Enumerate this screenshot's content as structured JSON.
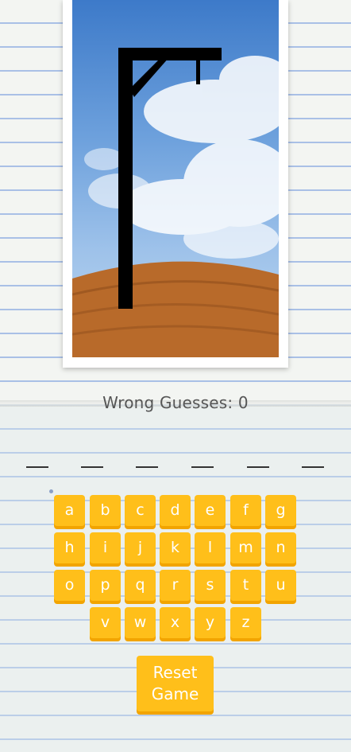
{
  "status": {
    "wrong_label": "Wrong Guesses: 0",
    "wrong_count": 0
  },
  "word": {
    "length": 6
  },
  "keyboard": {
    "rows": [
      [
        "a",
        "b",
        "c",
        "d",
        "e",
        "f",
        "g"
      ],
      [
        "h",
        "i",
        "j",
        "k",
        "l",
        "m",
        "n"
      ],
      [
        "o",
        "p",
        "q",
        "r",
        "s",
        "t",
        "u"
      ],
      [
        "v",
        "w",
        "x",
        "y",
        "z"
      ]
    ]
  },
  "reset": {
    "line1": "Reset",
    "line2": "Game"
  },
  "colors": {
    "key": "#ffbf1a",
    "key_shadow": "#f2a400",
    "text": "#555555"
  },
  "icons": {
    "gallows": "gallows-image"
  }
}
